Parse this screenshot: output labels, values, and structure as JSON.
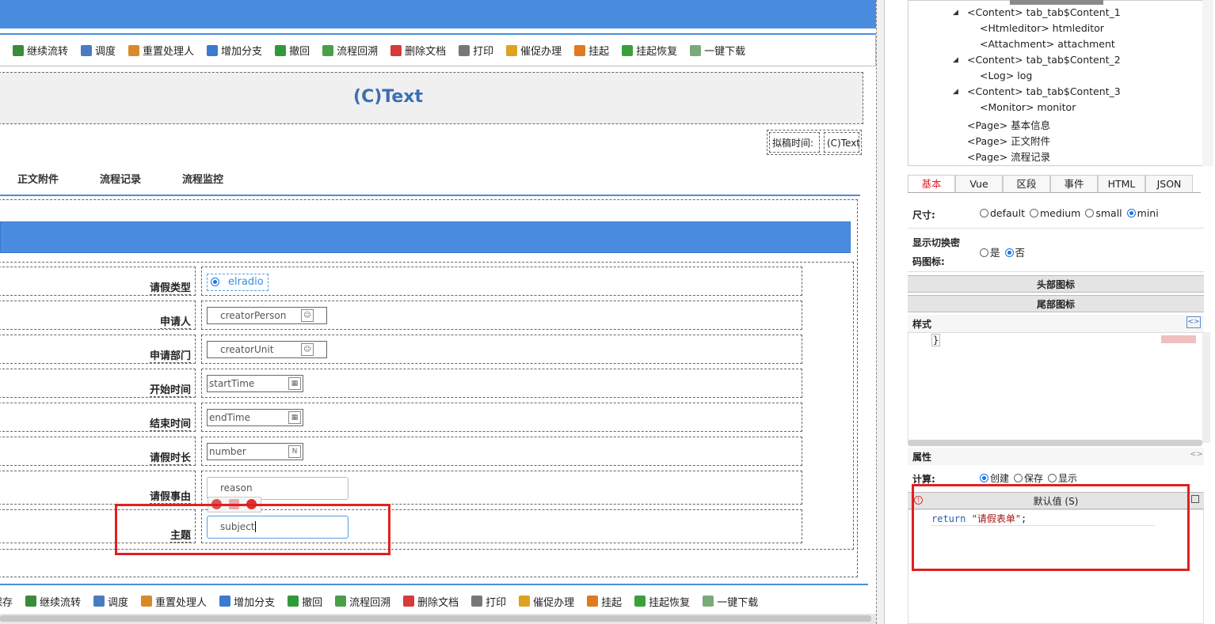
{
  "toolbar": {
    "items": [
      {
        "label": "继续流转",
        "icon": "forward-icon",
        "color": "#3b8b3b"
      },
      {
        "label": "调度",
        "icon": "dispatch-icon",
        "color": "#4a7bc0"
      },
      {
        "label": "重置处理人",
        "icon": "users-icon",
        "color": "#d88a2a"
      },
      {
        "label": "增加分支",
        "icon": "branch-icon",
        "color": "#3a7ad0"
      },
      {
        "label": "撤回",
        "icon": "undo-icon",
        "color": "#2f9a3a"
      },
      {
        "label": "流程回溯",
        "icon": "history-icon",
        "color": "#4aa04a"
      },
      {
        "label": "删除文档",
        "icon": "delete-icon",
        "color": "#d63a3a"
      },
      {
        "label": "打印",
        "icon": "print-icon",
        "color": "#777777"
      },
      {
        "label": "催促办理",
        "icon": "urge-icon",
        "color": "#e0a020"
      },
      {
        "label": "挂起",
        "icon": "pause-icon",
        "color": "#e07a20"
      },
      {
        "label": "挂起恢复",
        "icon": "resume-icon",
        "color": "#3aa03a"
      },
      {
        "label": "一键下载",
        "icon": "download-icon",
        "color": "#7aaa7a"
      }
    ],
    "bottom_first": "保存"
  },
  "form": {
    "title": "(C)Text",
    "date_label": "拟稿时间:",
    "date_value": "(C)Text",
    "tabs": [
      "正文附件",
      "流程记录",
      "流程监控"
    ],
    "rows": [
      {
        "label": "请假类型",
        "value": "elradio",
        "type": "radio"
      },
      {
        "label": "申请人",
        "value": "creatorPerson",
        "type": "person"
      },
      {
        "label": "申请部门",
        "value": "creatorUnit",
        "type": "person"
      },
      {
        "label": "开始时间",
        "value": "startTime",
        "type": "date"
      },
      {
        "label": "结束时间",
        "value": "endTime",
        "type": "date"
      },
      {
        "label": "请假时长",
        "value": "number",
        "type": "number"
      },
      {
        "label": "请假事由",
        "value": "reason",
        "type": "text"
      },
      {
        "label": "主题",
        "value": "subject",
        "type": "focus"
      }
    ]
  },
  "tree": {
    "nodes": [
      {
        "text": "<Content> tab_tab$Content_1",
        "level": 1,
        "expanded": true
      },
      {
        "text": "<Htmleditor> htmleditor",
        "level": 2
      },
      {
        "text": "<Attachment> attachment",
        "level": 2
      },
      {
        "text": "<Content> tab_tab$Content_2",
        "level": 1,
        "expanded": true
      },
      {
        "text": "<Log> log",
        "level": 2
      },
      {
        "text": "<Content> tab_tab$Content_3",
        "level": 1,
        "expanded": true
      },
      {
        "text": "<Monitor> monitor",
        "level": 2
      },
      {
        "text": "<Page> 基本信息",
        "level": 1
      },
      {
        "text": "<Page> 正文附件",
        "level": 1
      },
      {
        "text": "<Page> 流程记录",
        "level": 1
      }
    ]
  },
  "props": {
    "tabs": [
      "基本",
      "Vue",
      "区段",
      "事件",
      "HTML",
      "JSON"
    ],
    "size_label": "尺寸:",
    "size_options": [
      "default",
      "medium",
      "small",
      "mini"
    ],
    "size_selected": "mini",
    "pwd_label_1": "显示切换密",
    "pwd_label_2": "码图标:",
    "pwd_options": [
      "是",
      "否"
    ],
    "pwd_selected": "否",
    "head_icon": "头部图标",
    "tail_icon": "尾部图标",
    "style_label": "样式",
    "style_code": "}",
    "attr_label": "属性",
    "calc_label": "计算:",
    "calc_options": [
      "创建",
      "保存",
      "显示"
    ],
    "calc_selected": "创建",
    "default_label": "默认值 (S)",
    "code_keyword": "return",
    "code_string": "\"请假表单\"",
    "code_end": ";"
  }
}
